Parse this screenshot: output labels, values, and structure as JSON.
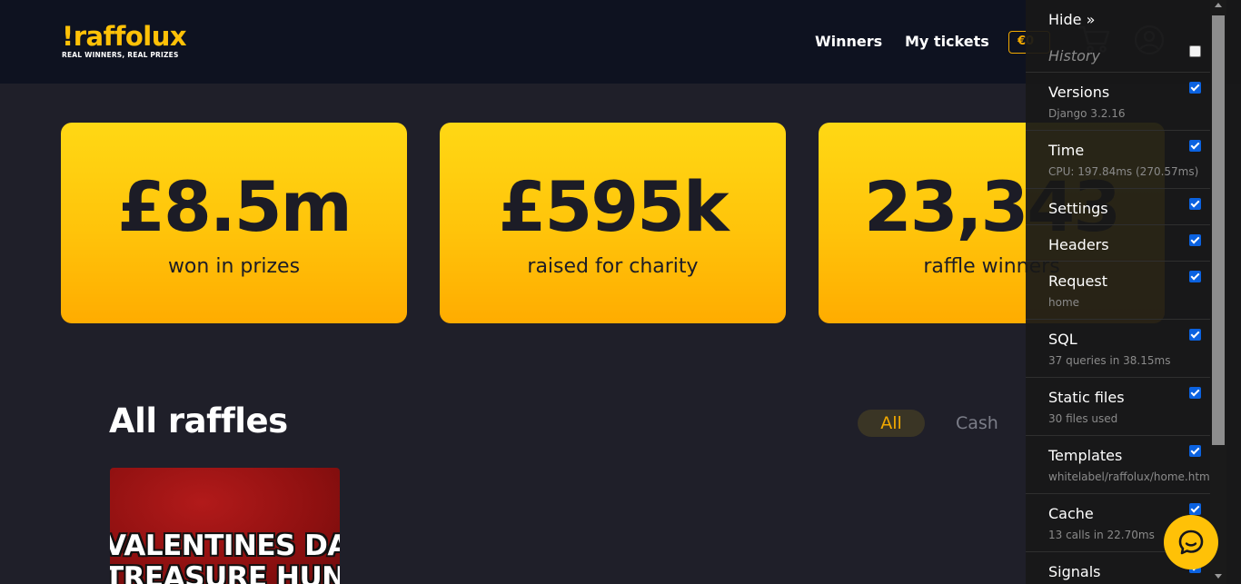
{
  "header": {
    "logo_word": "!raffolux",
    "logo_tagline": "REAL WINNERS, REAL PRIZES",
    "nav": {
      "winners": "Winners",
      "my_tickets": "My tickets"
    },
    "wallet_balance": "€0",
    "icons": [
      "cart-icon",
      "user-icon"
    ]
  },
  "stats": [
    {
      "value": "£8.5m",
      "label": "won in prizes"
    },
    {
      "value": "£595k",
      "label": "raised for charity"
    },
    {
      "value": "23,343",
      "label": "raffle winners"
    }
  ],
  "raffles": {
    "title": "All raffles",
    "filters": {
      "all": "All",
      "cash": "Cash"
    },
    "card": {
      "line1": "VALENTINES DAY",
      "line2": "TREASURE HUNT"
    }
  },
  "debug_toolbar": {
    "hide": "Hide »",
    "panels": [
      {
        "title": "History",
        "sub": "",
        "checked": false
      },
      {
        "title": "Versions",
        "sub": "Django 3.2.16",
        "checked": true
      },
      {
        "title": "Time",
        "sub": "CPU: 197.84ms (270.57ms)",
        "checked": true
      },
      {
        "title": "Settings",
        "sub": "",
        "checked": true
      },
      {
        "title": "Headers",
        "sub": "",
        "checked": true
      },
      {
        "title": "Request",
        "sub": "home",
        "checked": true
      },
      {
        "title": "SQL",
        "sub": "37 queries in 38.15ms",
        "checked": true
      },
      {
        "title": "Static files",
        "sub": "30 files used",
        "checked": true
      },
      {
        "title": "Templates",
        "sub": "whitelabel/raffolux/home.html",
        "checked": true
      },
      {
        "title": "Cache",
        "sub": "13 calls in 22.70ms",
        "checked": true
      },
      {
        "title": "Signals",
        "sub": "",
        "checked": true
      }
    ]
  },
  "colors": {
    "accent": "#ffc107",
    "header_bg": "#0e1220",
    "page_bg": "#1f1f29"
  }
}
